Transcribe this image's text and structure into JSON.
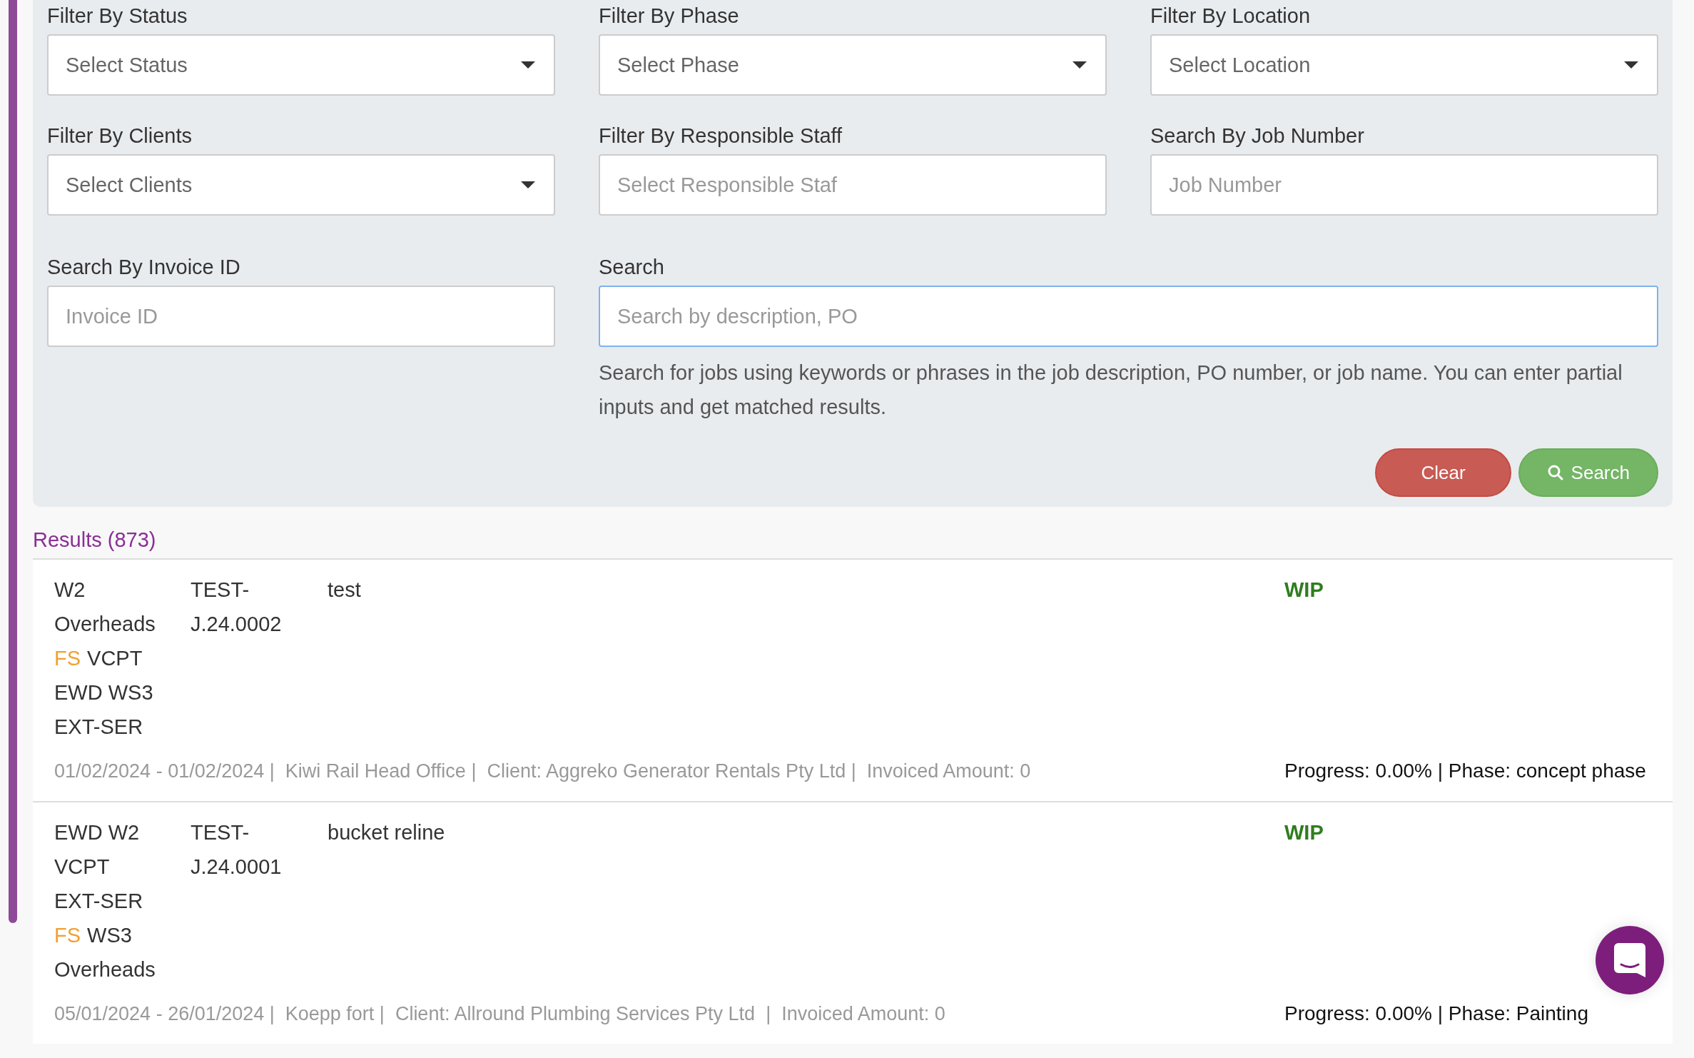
{
  "filters": [
    {
      "label": "Filter By Status",
      "kind": "select",
      "placeholder": "Select Status",
      "focused": false
    },
    {
      "label": "Filter By Phase",
      "kind": "select",
      "placeholder": "Select Phase",
      "focused": false
    },
    {
      "label": "Filter By Location",
      "kind": "select",
      "placeholder": "Select Location",
      "focused": false
    },
    {
      "label": "Filter By Clients",
      "kind": "select",
      "placeholder": "Select Clients",
      "focused": false
    },
    {
      "label": "Filter By Responsible Staff",
      "kind": "text",
      "placeholder": "Select Responsible Staf",
      "focused": false
    },
    {
      "label": "Search By Job Number",
      "kind": "text",
      "placeholder": "Job Number",
      "focused": false
    },
    {
      "label": "Search By Invoice ID",
      "kind": "text",
      "placeholder": "Invoice ID",
      "focused": false
    }
  ],
  "search": {
    "label": "Search",
    "placeholder": "Search by description, PO",
    "focused": true,
    "help": "Search for jobs using keywords or phrases in the job description, PO number, or job name. You can enter partial inputs and get matched results."
  },
  "buttons": [
    {
      "label": "Clear",
      "kind": "danger"
    },
    {
      "label": "Search",
      "kind": "primary"
    }
  ],
  "results_title": "Results (873)",
  "jobs": [
    {
      "tags": [
        [
          {
            "text": "W2",
            "highlight": false
          }
        ],
        [
          {
            "text": "Overheads",
            "highlight": false
          }
        ],
        [
          {
            "text": "FS",
            "highlight": true
          },
          {
            "text": "VCPT",
            "highlight": false
          }
        ],
        [
          {
            "text": "EWD WS3",
            "highlight": false
          }
        ],
        [
          {
            "text": "EXT-SER",
            "highlight": false
          }
        ]
      ],
      "job_number": "TEST-J.24.0002",
      "description": "test",
      "status": "WIP",
      "meta": "01/02/2024 - 01/02/2024 |  Kiwi Rail Head Office |  Client: Aggreko Generator Rentals Pty Ltd |  Invoiced Amount: 0",
      "progress": "Progress: 0.00% | Phase: concept phase"
    },
    {
      "tags": [
        [
          {
            "text": "EWD W2",
            "highlight": false
          }
        ],
        [
          {
            "text": "VCPT",
            "highlight": false
          }
        ],
        [
          {
            "text": "EXT-SER",
            "highlight": false
          }
        ],
        [
          {
            "text": "FS",
            "highlight": true
          },
          {
            "text": "WS3",
            "highlight": false
          }
        ],
        [
          {
            "text": "Overheads",
            "highlight": false
          }
        ]
      ],
      "job_number": "TEST-J.24.0001",
      "description": "bucket reline",
      "status": "WIP",
      "meta": "05/01/2024 - 26/01/2024 |  Koepp fort |  Client: Allround Plumbing Services Pty Ltd  |  Invoiced Amount: 0",
      "progress": "Progress: 0.00% | Phase: Painting"
    }
  ]
}
